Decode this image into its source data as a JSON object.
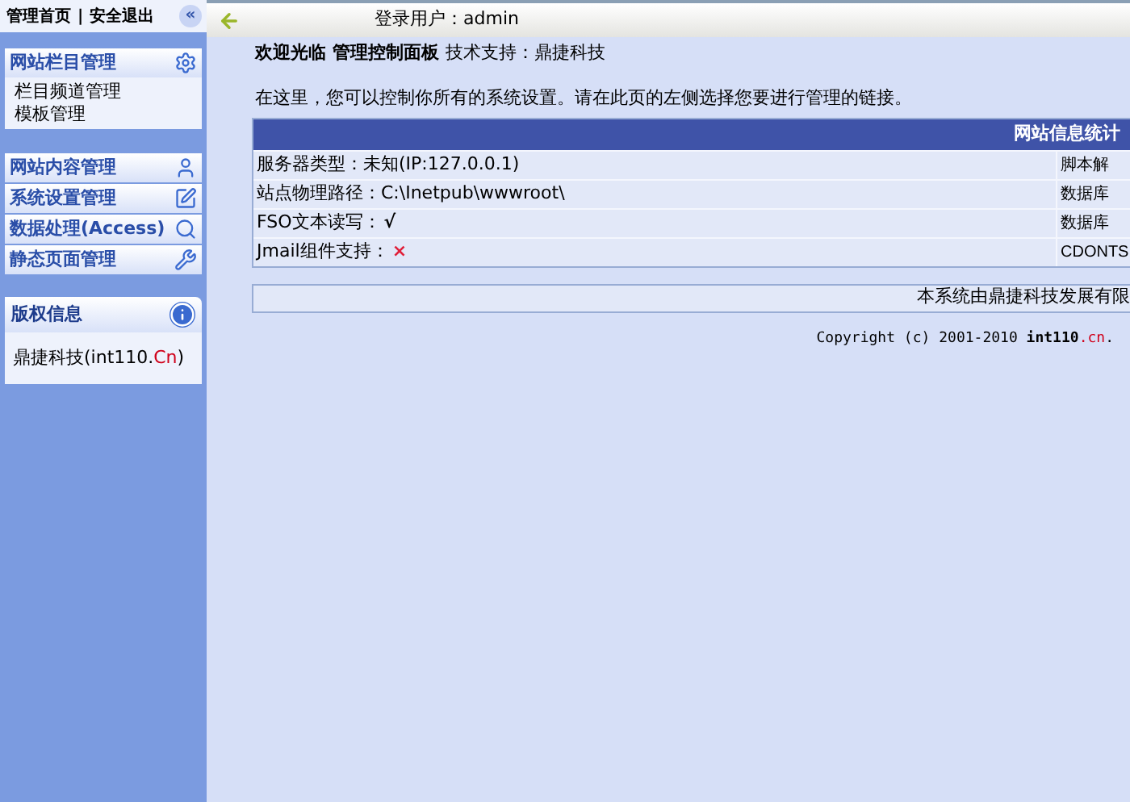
{
  "sidebar": {
    "top_links": [
      "管理首页",
      "安全退出"
    ],
    "separator": "|",
    "collapse_glyph": "«",
    "groups": [
      {
        "title": "网站栏目管理",
        "items": [
          "栏目频道管理",
          "模板管理"
        ]
      },
      {
        "title": "网站内容管理"
      },
      {
        "title": "系统设置管理"
      },
      {
        "title": "数据处理(Access)"
      },
      {
        "title": "静态页面管理"
      }
    ],
    "info": {
      "title": "版权信息",
      "parts": [
        {
          "text": "鼎捷科技(int110.",
          "kind": "plain"
        },
        {
          "text": "Cn",
          "kind": "accent"
        },
        {
          "text": ")",
          "kind": "plain"
        }
      ]
    }
  },
  "topbar": {
    "user_label": "登录用户：admin"
  },
  "welcome": {
    "title": "欢迎光临 管理控制面板",
    "support": "技术支持：鼎捷科技"
  },
  "intro": "在这里，您可以控制你所有的系统设置。请在此页的左侧选择您要进行管理的链接。",
  "stats": {
    "title": "网站信息统计",
    "rows": [
      {
        "kind": "text",
        "label": "服务器类型：未知(IP:127.0.0.1)",
        "column_2": "脚本解"
      },
      {
        "kind": "text",
        "label": "站点物理路径：C:\\Inetpub\\wwwroot\\",
        "column_2": "数据库"
      },
      {
        "kind": "check",
        "label": "FSO文本读写：",
        "glyph": "√",
        "column_2": "数据库"
      },
      {
        "kind": "cross",
        "label": "Jmail组件支持：",
        "glyph": "×",
        "column_2": "CDONTS"
      }
    ]
  },
  "footer": {
    "company": "本系统由鼎捷科技发展有限",
    "copyright": [
      {
        "text": "Copyright (c) 2001-2010 ",
        "kind": "plain"
      },
      {
        "text": "int110",
        "kind": "bold"
      },
      {
        "text": ".cn",
        "kind": "accent"
      },
      {
        "text": ".",
        "kind": "plain"
      }
    ]
  }
}
